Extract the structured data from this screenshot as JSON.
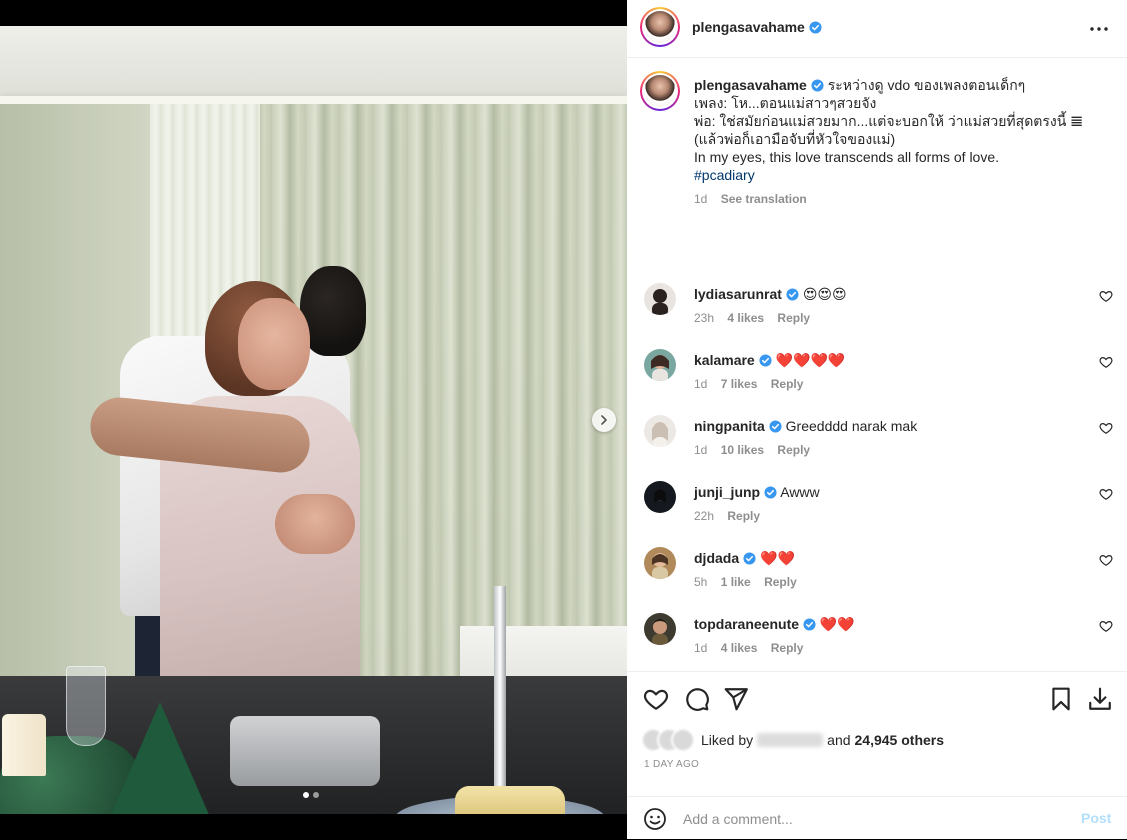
{
  "post": {
    "author": "plengasavahame",
    "verified": true,
    "carousel": {
      "current_slide": 1,
      "total_slides": 2
    }
  },
  "caption": {
    "username": "plengasavahame",
    "lines": [
      "ระหว่างดู vdo ของเพลงตอนเด็กๆ",
      "",
      "เพลง: โห...ตอนแม่สาวๆสวยจัง",
      "",
      "พ่อ: ใช่สมัยก่อนแม่สวยมาก...แต่จะบอกให้ ว่าแม่สวยที่สุดตรงนี้ 𝌆",
      "(แล้วพ่อก็เอามือจับที่หัวใจของแม่)",
      "",
      "In my eyes, this love transcends all forms of love."
    ],
    "hashtag": "#pcadiary",
    "time": "1d",
    "see_translation": "See translation"
  },
  "comments": [
    {
      "username": "lydiasarunrat",
      "text": "😍😍😍",
      "time": "23h",
      "likes": "4 likes",
      "reply": "Reply",
      "avatar_color": "#2a221f"
    },
    {
      "username": "kalamare",
      "text": "❤️❤️❤️❤️",
      "time": "1d",
      "likes": "7 likes",
      "reply": "Reply",
      "avatar_color": "#7aa7a0"
    },
    {
      "username": "ningpanita",
      "text": "Greedddd narak mak",
      "time": "1d",
      "likes": "10 likes",
      "reply": "Reply",
      "avatar_color": "#c9c1b8"
    },
    {
      "username": "junji_junp",
      "text": "Awww",
      "time": "22h",
      "likes": "",
      "reply": "Reply",
      "avatar_color": "#15181f"
    },
    {
      "username": "djdada",
      "text": "❤️❤️",
      "time": "5h",
      "likes": "1 like",
      "reply": "Reply",
      "avatar_color": "#b08a5a"
    },
    {
      "username": "topdaraneenute",
      "text": "❤️❤️",
      "time": "1d",
      "likes": "4 likes",
      "reply": "Reply",
      "avatar_color": "#3d3a2f"
    }
  ],
  "likes": {
    "prefix": "Liked by",
    "and": "and",
    "count_text": "24,945 others"
  },
  "timestamp": "1 DAY AGO",
  "comment_box": {
    "placeholder": "Add a comment...",
    "post_label": "Post"
  },
  "colors": {
    "verified": "#3897f0",
    "link": "#00376b",
    "muted": "#8e8e8e",
    "post_disabled": "#b2dffc"
  },
  "icons": {
    "like": "heart-icon",
    "comment": "comment-icon",
    "share": "paper-plane-icon",
    "save": "bookmark-icon",
    "download": "download-icon",
    "more": "more-dots-icon",
    "next": "chevron-right-icon",
    "emoji": "emoji-icon"
  }
}
